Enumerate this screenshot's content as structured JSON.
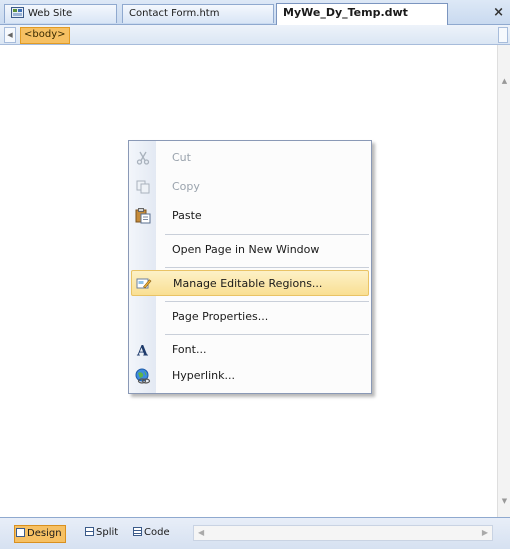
{
  "tabs": [
    {
      "label": "Web Site",
      "icon": "website-icon",
      "active": false
    },
    {
      "label": "Contact Form.htm",
      "icon": "",
      "active": false
    },
    {
      "label": "MyWe_Dy_Temp.dwt",
      "icon": "",
      "active": true
    }
  ],
  "close_glyph": "×",
  "tag_selector": {
    "tag": "<body>"
  },
  "context_menu": {
    "items": [
      {
        "label": "Cut",
        "icon": "scissors-icon",
        "enabled": false
      },
      {
        "label": "Copy",
        "icon": "copy-icon",
        "enabled": false
      },
      {
        "label": "Paste",
        "icon": "paste-icon",
        "enabled": true
      },
      {
        "label": "Open Page in New Window",
        "icon": "",
        "enabled": true
      },
      {
        "label": "Manage Editable Regions...",
        "icon": "editable-regions-icon",
        "enabled": true,
        "highlighted": true
      },
      {
        "label": "Page Properties...",
        "icon": "",
        "enabled": true
      },
      {
        "label": "Font...",
        "icon": "font-icon",
        "enabled": true
      },
      {
        "label": "Hyperlink...",
        "icon": "hyperlink-icon",
        "enabled": true
      }
    ]
  },
  "view_bar": {
    "design": "Design",
    "split": "Split",
    "code": "Code",
    "active": "Design"
  },
  "colors": {
    "highlight": "#f9df93",
    "tag_accent": "#f6c063",
    "chrome_blue": "#c9daf0"
  }
}
